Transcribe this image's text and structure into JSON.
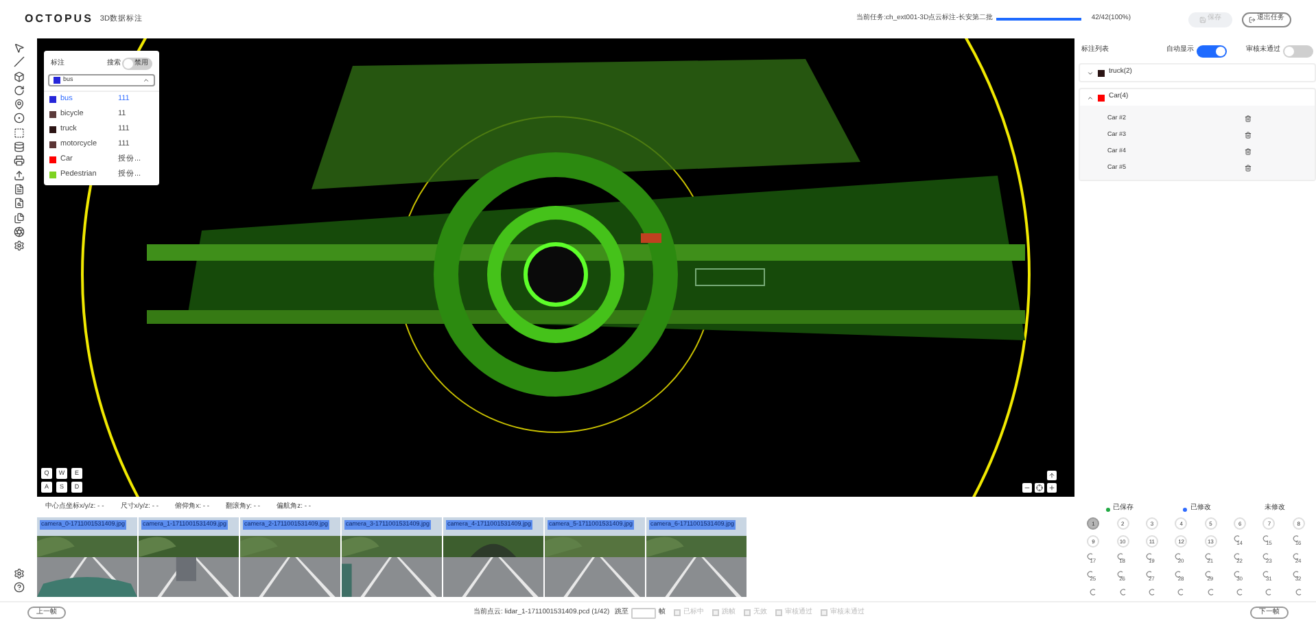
{
  "header": {
    "logo": "OCTOPUS",
    "subtitle": "3D数据标注",
    "task": "当前任务:ch_ext001-3D点云标注-长安第二批",
    "progress": {
      "level": 1,
      "reading": "42/42(100%)"
    },
    "save_button": {
      "label": "保存",
      "disabled": true
    },
    "exit_button": {
      "label": "退出任务"
    }
  },
  "label_dropdown": {
    "title": "标注",
    "search_label": "搜索",
    "search_toggle": {
      "on": false,
      "label": "禁用"
    },
    "selected_value": "bus",
    "options": [
      {
        "name": "bus",
        "count": "111",
        "color": "#2626d9",
        "selected": true
      },
      {
        "name": "bicycle",
        "count": "11",
        "color": "#5c3b3b",
        "selected": false
      },
      {
        "name": "truck",
        "count": "111",
        "color": "#2b1414",
        "selected": false
      },
      {
        "name": "motorcycle",
        "count": "111",
        "color": "#5c3535",
        "selected": false
      },
      {
        "name": "Car",
        "count": "授份...",
        "color": "#ff0000",
        "selected": false
      },
      {
        "name": "Pedestrian",
        "count": "授份...",
        "color": "#7ed321",
        "selected": false
      }
    ]
  },
  "keys": [
    [
      "Q",
      "W",
      "E"
    ],
    [
      "A",
      "S",
      "D"
    ]
  ],
  "info_row": [
    "中心点坐标x/y/z: - -",
    "尺寸x/y/z: - -",
    "俯仰角x: - -",
    "翻滚角y: - -",
    "偏航角z: - -"
  ],
  "thumbnails": [
    "camera_0-1711001531409.jpg",
    "camera_1-1711001531409.jpg",
    "camera_2-1711001531409.jpg",
    "camera_3-1711001531409.jpg",
    "camera_4-1711001531409.jpg",
    "camera_5-1711001531409.jpg",
    "camera_6-1711001531409.jpg"
  ],
  "annotation_list": {
    "title": "标注列表",
    "auto_show": {
      "label": "自动显示",
      "on": true
    },
    "review_failed": {
      "label": "审核未通过",
      "on": false
    },
    "groups": [
      {
        "name": "truck(2)",
        "color": "#2b1414",
        "expanded": false
      },
      {
        "name": "Car(4)",
        "color": "#ff0000",
        "expanded": true,
        "children": [
          "Car #2",
          "Car #3",
          "Car #4",
          "Car #5"
        ]
      }
    ]
  },
  "legend": [
    {
      "label": "已保存",
      "color": "#22aa44"
    },
    {
      "label": "已修改",
      "color": "#2f6bff"
    },
    {
      "label": "未修改"
    }
  ],
  "frames": [
    {
      "kind": "done",
      "label": "1",
      "selected": true
    },
    {
      "kind": "done",
      "label": "2",
      "selected": false
    },
    {
      "kind": "done",
      "label": "3",
      "selected": false
    },
    {
      "kind": "done",
      "label": "4",
      "selected": false
    },
    {
      "kind": "done",
      "label": "5",
      "selected": false
    },
    {
      "kind": "done",
      "label": "6",
      "selected": false
    },
    {
      "kind": "done",
      "label": "7",
      "selected": false
    },
    {
      "kind": "done",
      "label": "8",
      "selected": false
    },
    {
      "kind": "done",
      "label": "9",
      "selected": false
    },
    {
      "kind": "done",
      "label": "10",
      "selected": false
    },
    {
      "kind": "done",
      "label": "11",
      "selected": false
    },
    {
      "kind": "done",
      "label": "12",
      "selected": false
    },
    {
      "kind": "done",
      "label": "13",
      "selected": false
    },
    {
      "kind": "loading",
      "label": "14",
      "selected": false
    },
    {
      "kind": "loading",
      "label": "15",
      "selected": false
    },
    {
      "kind": "loading",
      "label": "16",
      "selected": false
    },
    {
      "kind": "loading",
      "label": "17",
      "selected": false
    },
    {
      "kind": "loading",
      "label": "18",
      "selected": false
    },
    {
      "kind": "loading",
      "label": "19",
      "selected": false
    },
    {
      "kind": "loading",
      "label": "20",
      "selected": false
    },
    {
      "kind": "loading",
      "label": "21",
      "selected": false
    },
    {
      "kind": "loading",
      "label": "22",
      "selected": false
    },
    {
      "kind": "loading",
      "label": "23",
      "selected": false
    },
    {
      "kind": "loading",
      "label": "24",
      "selected": false
    },
    {
      "kind": "loading",
      "label": "25",
      "selected": false
    },
    {
      "kind": "loading",
      "label": "26",
      "selected": false
    },
    {
      "kind": "loading",
      "label": "27",
      "selected": false
    },
    {
      "kind": "loading",
      "label": "28",
      "selected": false
    },
    {
      "kind": "loading",
      "label": "29",
      "selected": false
    },
    {
      "kind": "loading",
      "label": "30",
      "selected": false
    },
    {
      "kind": "loading",
      "label": "31",
      "selected": false
    },
    {
      "kind": "loading",
      "label": "32",
      "selected": false
    },
    {
      "kind": "cut"
    },
    {
      "kind": "cut"
    },
    {
      "kind": "cut"
    },
    {
      "kind": "cut"
    },
    {
      "kind": "cut"
    },
    {
      "kind": "cut"
    },
    {
      "kind": "cut"
    },
    {
      "kind": "cut"
    }
  ],
  "footer": {
    "prev_button": "上一帧",
    "current": "当前点云: lidar_1-1711001531409.pcd (1/42)",
    "jump_label": "跳至",
    "jump_unit": "帧",
    "flags": [
      {
        "label": "已标中",
        "checked": false
      },
      {
        "label": "跳帧",
        "checked": false
      },
      {
        "label": "无效",
        "checked": false
      },
      {
        "label": "审核通过",
        "checked": false
      },
      {
        "label": "审核未通过",
        "checked": false
      }
    ],
    "next_button": "下一帧"
  }
}
